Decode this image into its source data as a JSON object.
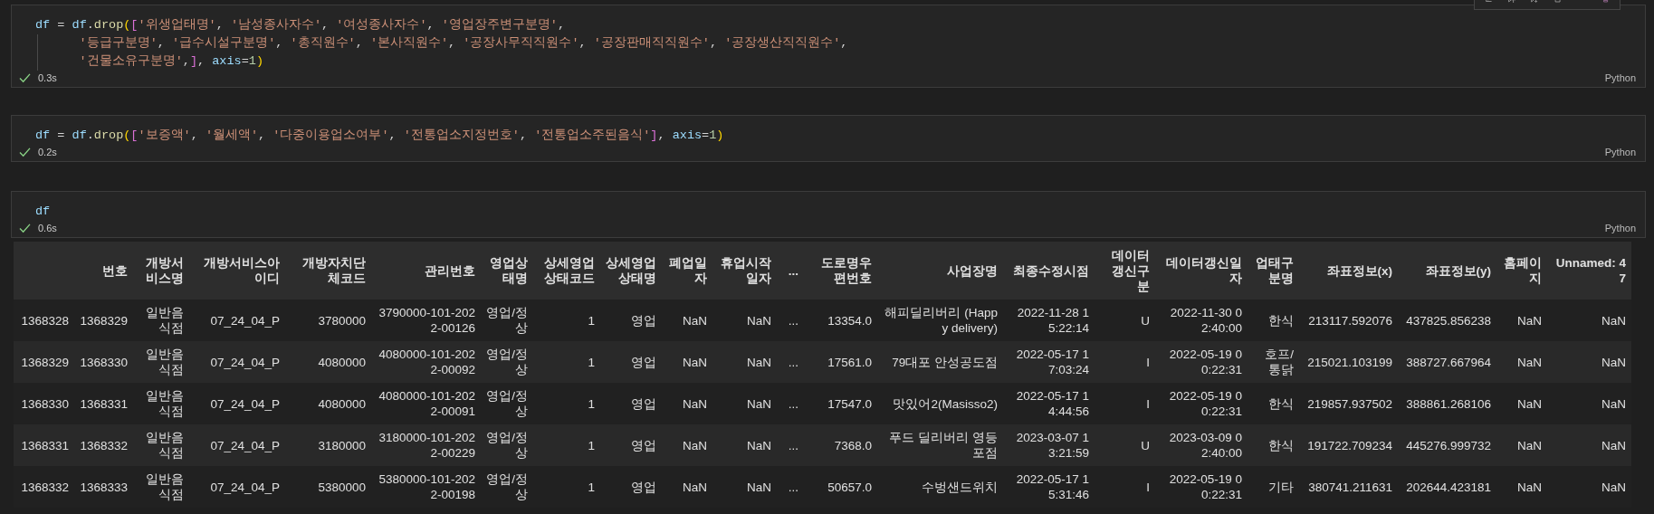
{
  "cells": [
    {
      "code": [
        "df = df.drop(['위생업태명', '남성종사자수', '여성종사자수', '영업장주변구분명',",
        "      '등급구분명', '급수시설구분명', '총직원수', '본사직원수', '공장사무직직원수', '공장판매직직원수', '공장생산직직원수',",
        "      '건물소유구분명',], axis=1)"
      ],
      "succeeded": true,
      "time": "0.3s",
      "language": "Python"
    },
    {
      "code": [
        "df = df.drop(['보증액', '월세액', '다중이용업소여부', '전통업소지정번호', '전통업소주된음식'], axis=1)"
      ],
      "succeeded": true,
      "time": "0.2s",
      "language": "Python"
    },
    {
      "code": [
        "df"
      ],
      "succeeded": true,
      "time": "0.6s",
      "language": "Python"
    }
  ],
  "output_table": {
    "columns": [
      "번호",
      "개방서비스명",
      "개방서비스아이디",
      "개방자치단체코드",
      "관리번호",
      "영업상태명",
      "상세영업상태코드",
      "상세영업상태명",
      "폐업일자",
      "휴업시작일자",
      "...",
      "도로명우편번호",
      "사업장명",
      "최종수정시점",
      "데이터갱신구분",
      "데이터갱신일자",
      "업태구분명",
      "좌표정보(x)",
      "좌표정보(y)",
      "홈페이지",
      "Unnamed: 47"
    ],
    "rows": [
      {
        "index": "1368328",
        "cells": [
          "1368329",
          "일반음식점",
          "07_24_04_P",
          "3780000",
          "3790000-101-2022-00126",
          "영업/정상",
          "1",
          "영업",
          "NaN",
          "NaN",
          "...",
          "13354.0",
          "해피딜리버리 (Happy delivery)",
          "2022-11-28 15:22:14",
          "U",
          "2022-11-30 02:40:00",
          "한식",
          "213117.592076",
          "437825.856238",
          "NaN",
          "NaN"
        ]
      },
      {
        "index": "1368329",
        "cells": [
          "1368330",
          "일반음식점",
          "07_24_04_P",
          "4080000",
          "4080000-101-2022-00092",
          "영업/정상",
          "1",
          "영업",
          "NaN",
          "NaN",
          "...",
          "17561.0",
          "79대포 안성공도점",
          "2022-05-17 17:03:24",
          "I",
          "2022-05-19 00:22:31",
          "호프/통닭",
          "215021.103199",
          "388727.667964",
          "NaN",
          "NaN"
        ]
      },
      {
        "index": "1368330",
        "cells": [
          "1368331",
          "일반음식점",
          "07_24_04_P",
          "4080000",
          "4080000-101-2022-00091",
          "영업/정상",
          "1",
          "영업",
          "NaN",
          "NaN",
          "...",
          "17547.0",
          "맛있어2(Masisso2)",
          "2022-05-17 14:44:56",
          "I",
          "2022-05-19 00:22:31",
          "한식",
          "219857.937502",
          "388861.268106",
          "NaN",
          "NaN"
        ]
      },
      {
        "index": "1368331",
        "cells": [
          "1368332",
          "일반음식점",
          "07_24_04_P",
          "3180000",
          "3180000-101-2022-00229",
          "영업/정상",
          "1",
          "영업",
          "NaN",
          "NaN",
          "...",
          "7368.0",
          "푸드 딜리버리 영등포점",
          "2023-03-07 13:21:59",
          "U",
          "2023-03-09 02:40:00",
          "한식",
          "191722.709234",
          "445276.999732",
          "NaN",
          "NaN"
        ]
      },
      {
        "index": "1368332",
        "cells": [
          "1368333",
          "일반음식점",
          "07_24_04_P",
          "5380000",
          "5380000-101-2022-00198",
          "영업/정상",
          "1",
          "영업",
          "NaN",
          "NaN",
          "...",
          "50657.0",
          "수벙샌드위치",
          "2022-05-17 15:31:46",
          "I",
          "2022-05-19 00:22:31",
          "기타",
          "380741.211631",
          "202644.423181",
          "NaN",
          "NaN"
        ]
      }
    ]
  }
}
